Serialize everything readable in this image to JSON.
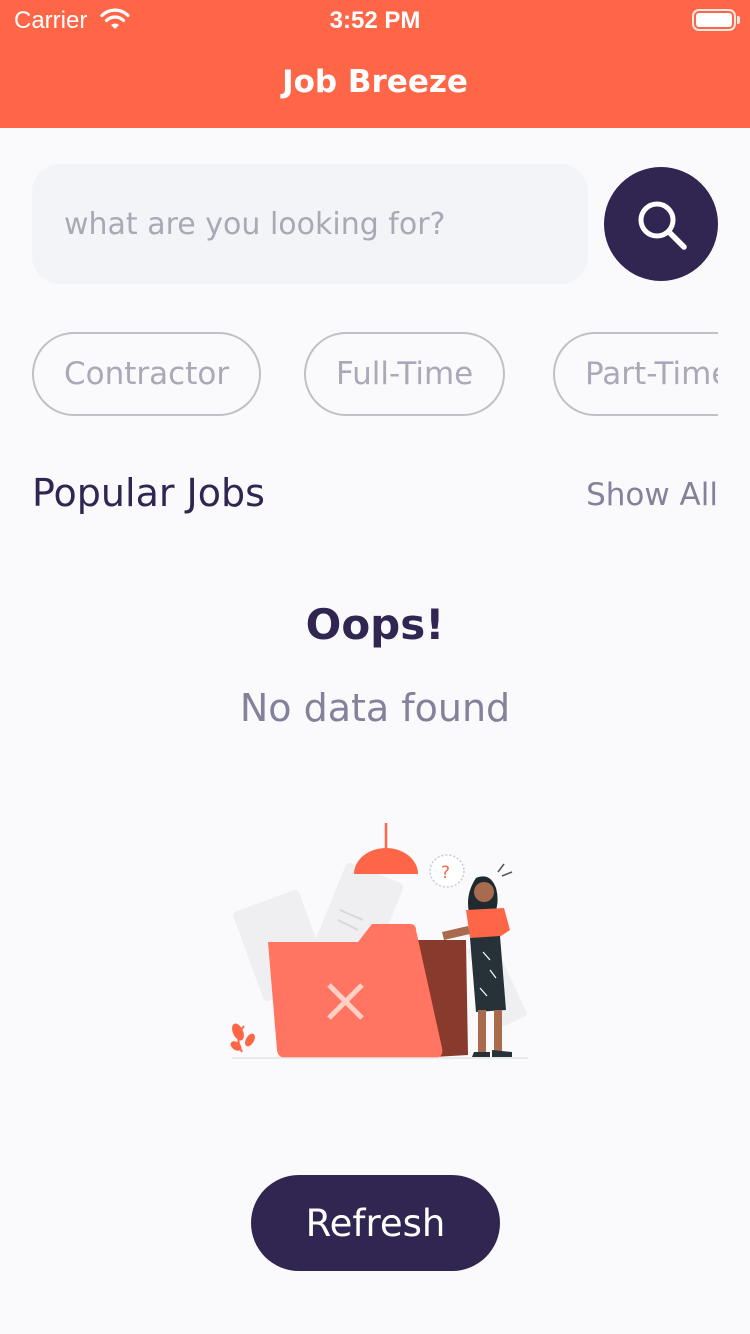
{
  "status_bar": {
    "carrier": "Carrier",
    "time": "3:52 PM"
  },
  "app": {
    "title": "Job Breeze",
    "header_color": "#FF6648",
    "accent_color": "#312651"
  },
  "search": {
    "placeholder": "what are you looking for?",
    "value": "",
    "button_icon": "search-icon"
  },
  "job_types": [
    {
      "label": "Contractor"
    },
    {
      "label": "Full-Time"
    },
    {
      "label": "Part-Time"
    }
  ],
  "popular": {
    "title": "Popular Jobs",
    "show_all_label": "Show All"
  },
  "empty_state": {
    "heading": "Oops!",
    "message": "No data found",
    "illustration_icon": "empty-folder-illustration"
  },
  "refresh_label": "Refresh"
}
